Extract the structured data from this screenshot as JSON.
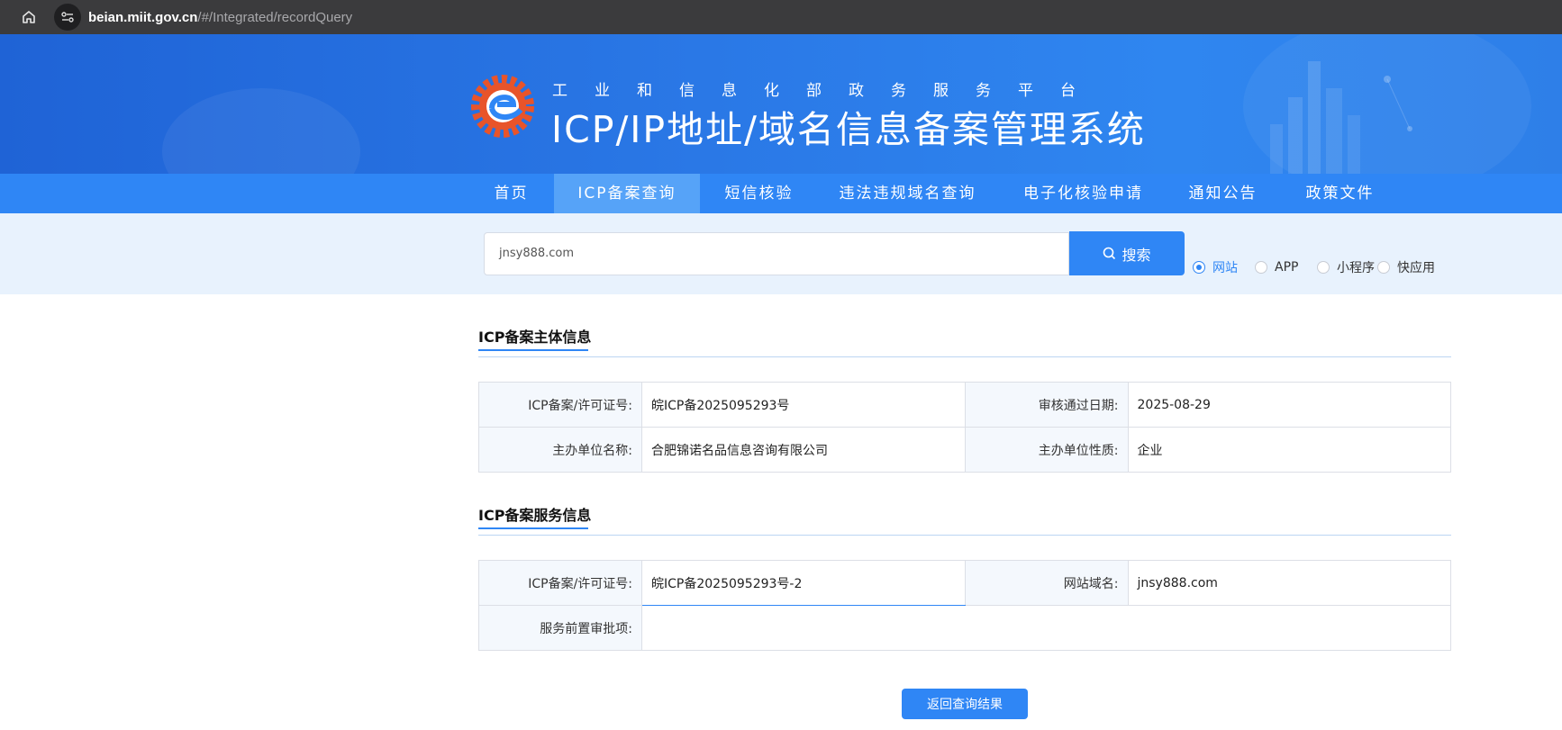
{
  "browser": {
    "url_host": "beian.miit.gov.cn",
    "url_path": "/#/Integrated/recordQuery"
  },
  "header": {
    "subtitle": "工业和信息化部政务服务平台",
    "title": "ICP/IP地址/域名信息备案管理系统"
  },
  "nav": {
    "items": [
      {
        "label": "首页"
      },
      {
        "label": "ICP备案查询"
      },
      {
        "label": "短信核验"
      },
      {
        "label": "违法违规域名查询"
      },
      {
        "label": "电子化核验申请"
      },
      {
        "label": "通知公告"
      },
      {
        "label": "政策文件"
      }
    ],
    "active_index": 1
  },
  "search": {
    "value": "jnsy888.com",
    "button_label": "搜索",
    "options": [
      {
        "label": "网站",
        "checked": true
      },
      {
        "label": "APP",
        "checked": false
      },
      {
        "label": "小程序",
        "checked": false
      },
      {
        "label": "快应用",
        "checked": false
      }
    ]
  },
  "subject_info": {
    "title": "ICP备案主体信息",
    "rows": [
      {
        "label1": "ICP备案/许可证号:",
        "value1": "皖ICP备2025095293号",
        "label2": "审核通过日期:",
        "value2": "2025-08-29"
      },
      {
        "label1": "主办单位名称:",
        "value1": "合肥锦诺名品信息咨询有限公司",
        "label2": "主办单位性质:",
        "value2": "企业"
      }
    ]
  },
  "service_info": {
    "title": "ICP备案服务信息",
    "row1": {
      "label1": "ICP备案/许可证号:",
      "value1": "皖ICP备2025095293号-2",
      "label2": "网站域名:",
      "value2": "jnsy888.com"
    },
    "row2": {
      "label": "服务前置审批项:",
      "value": ""
    }
  },
  "back_button_label": "返回查询结果",
  "colors": {
    "primary": "#2f86f5",
    "nav_active": "#56a3f8",
    "label_bg": "#f4f8fd",
    "search_band": "#e8f2fd",
    "logo_orange": "#e8542a"
  }
}
